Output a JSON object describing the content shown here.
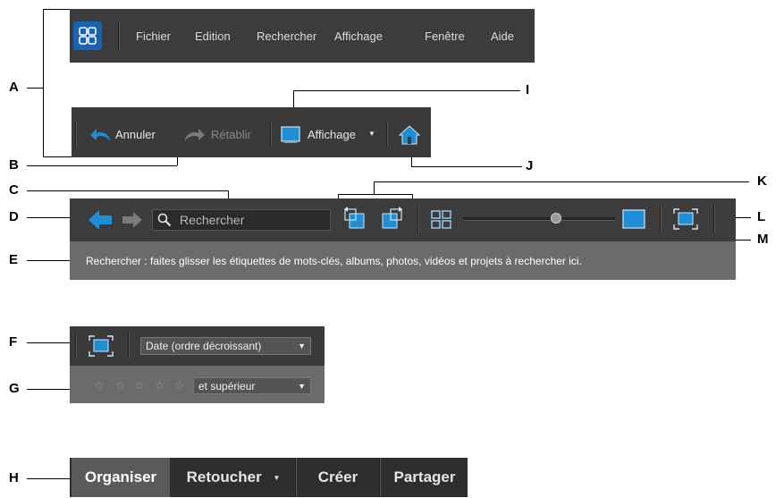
{
  "callouts": {
    "A": "A",
    "B": "B",
    "C": "C",
    "D": "D",
    "E": "E",
    "F": "F",
    "G": "G",
    "H": "H",
    "I": "I",
    "J": "J",
    "K": "K",
    "L": "L",
    "M": "M"
  },
  "menubar": {
    "items": [
      "Fichier",
      "Edition",
      "Rechercher",
      "Affichage",
      "Fenêtre",
      "Aide"
    ]
  },
  "edit_toolbar": {
    "undo_label": "Annuler",
    "redo_label": "Rétablir",
    "view_label": "Affichage"
  },
  "search_bar": {
    "placeholder": "Rechercher",
    "hint": "Rechercher : faites glisser les étiquettes de mots-clés, albums, photos, vidéos et projets à rechercher ici."
  },
  "sort_bar": {
    "sort_value": "Date  (ordre décroissant)",
    "rating_filter": "et supérieur",
    "stars": [
      "☆",
      "☆",
      "☆",
      "☆",
      "☆"
    ]
  },
  "mode_tabs": [
    {
      "label": "Organiser"
    },
    {
      "label": "Retoucher"
    },
    {
      "label": "Créer"
    },
    {
      "label": "Partager"
    }
  ],
  "colors": {
    "accent_blue": "#1e8ed6",
    "toolbar_dark": "#3a3a3a",
    "hint_gray": "#6b6b6b"
  }
}
